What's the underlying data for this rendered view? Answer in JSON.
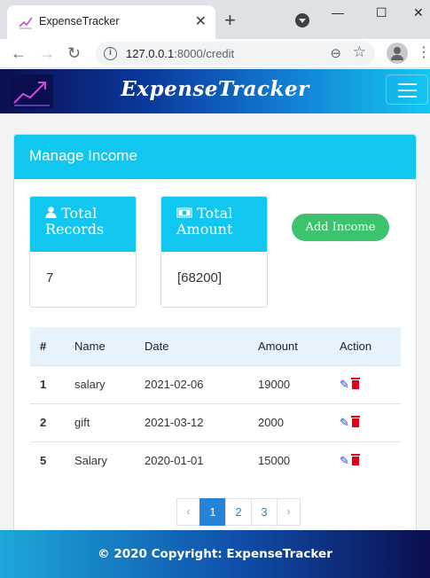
{
  "browser": {
    "tab_title": "ExpenseTracker",
    "tab_close": "✕",
    "new_tab": "+",
    "window_controls": {
      "minimize": "—",
      "maximize": "☐",
      "close": "✕"
    },
    "nav": {
      "back": "←",
      "forward": "→",
      "reload": "↻"
    },
    "url_host": "127.0.0.1",
    "url_path": ":8000/credit",
    "info_icon": "i",
    "zoom_icon": "⊖",
    "star_icon": "☆",
    "menu_icon": "⋮"
  },
  "app": {
    "brand": "ExpenseTracker",
    "card_title": "Manage Income",
    "stats": [
      {
        "icon": "user-icon",
        "label_line1": "Total",
        "label_line2": "Records",
        "value": "7"
      },
      {
        "icon": "money-icon",
        "label_line1": "Total",
        "label_line2": "Amount",
        "value": "[68200]"
      }
    ],
    "add_button": "Add Income",
    "table": {
      "headers": [
        "#",
        "Name",
        "Date",
        "Amount",
        "Action"
      ],
      "rows": [
        {
          "id": "1",
          "name": "salary",
          "date": "2021-02-06",
          "amount": "19000"
        },
        {
          "id": "2",
          "name": "gift",
          "date": "2021-03-12",
          "amount": "2000"
        },
        {
          "id": "5",
          "name": "Salary",
          "date": "2020-01-01",
          "amount": "15000"
        }
      ]
    },
    "pagination": {
      "prev": "‹",
      "pages": [
        "1",
        "2",
        "3"
      ],
      "next": "›",
      "current": "1"
    },
    "footer": "© 2020 Copyright: ExpenseTracker"
  },
  "colors": {
    "accent": "#11c7f0",
    "success": "#3cc36e",
    "page_active": "#2683d8",
    "delete": "#e0001a",
    "edit": "#2d3ecf"
  }
}
